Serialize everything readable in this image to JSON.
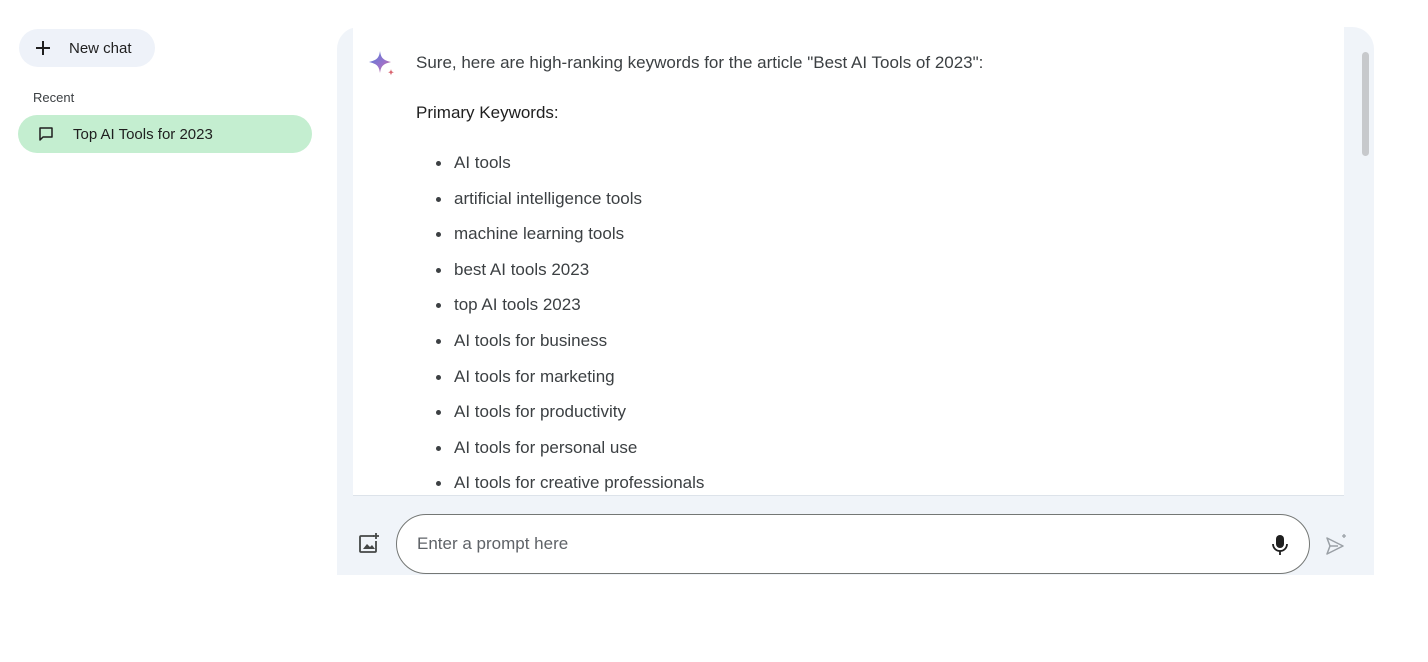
{
  "sidebar": {
    "new_chat_label": "New chat",
    "recent_heading": "Recent",
    "recent_items": [
      {
        "label": "Top AI Tools for 2023"
      }
    ]
  },
  "response": {
    "intro": "Sure, here are high-ranking keywords for the article \"Best AI Tools of 2023\":",
    "section_heading": "Primary Keywords:",
    "keywords": [
      "AI tools",
      "artificial intelligence tools",
      "machine learning tools",
      "best AI tools 2023",
      "top AI tools 2023",
      "AI tools for business",
      "AI tools for marketing",
      "AI tools for productivity",
      "AI tools for personal use",
      "AI tools for creative professionals"
    ]
  },
  "input": {
    "placeholder": "Enter a prompt here",
    "value": ""
  },
  "icons": {
    "new_chat": "plus-icon",
    "recent_item": "chat-bubble-icon",
    "assistant": "sparkle-icon",
    "image_upload": "add-image-icon",
    "mic": "microphone-icon",
    "send": "send-icon"
  },
  "colors": {
    "recent_item_active_bg": "#c4eed0",
    "main_panel_bg": "#f0f4f9",
    "new_chat_bg": "#eef2f9",
    "sparkle_blue": "#4f7bd8",
    "sparkle_red": "#d96570"
  }
}
